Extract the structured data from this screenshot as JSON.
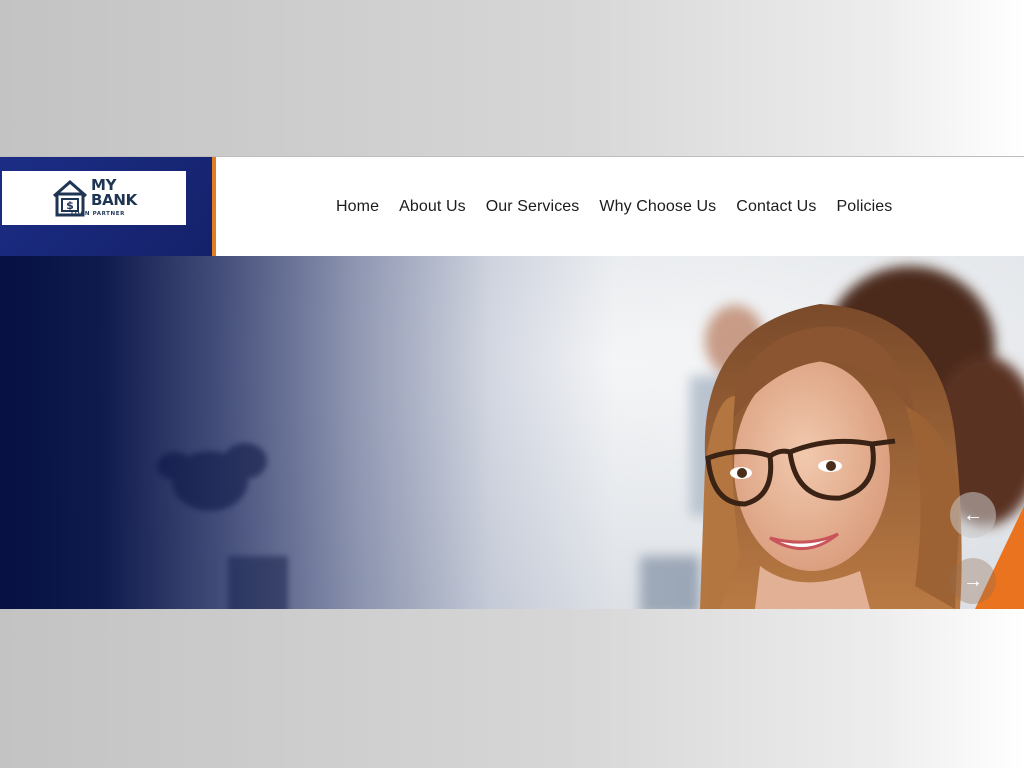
{
  "brand": {
    "name_line1": "MY",
    "name_line2": "BANK",
    "tagline": "LOAN PARTNER",
    "logo_icon": "house-dollar-icon",
    "primary_color": "#1c2d86",
    "accent_color": "#e27d25",
    "text_color": "#1e3553"
  },
  "nav": {
    "items": [
      {
        "label": "Home"
      },
      {
        "label": "About Us"
      },
      {
        "label": "Our Services"
      },
      {
        "label": "Why Choose Us"
      },
      {
        "label": "Contact Us"
      },
      {
        "label": "Policies"
      }
    ]
  },
  "hero": {
    "prev_arrow": "←",
    "next_arrow": "→",
    "prev_icon": "arrow-left-icon",
    "next_icon": "arrow-right-icon",
    "overlay_color": "#061042"
  }
}
